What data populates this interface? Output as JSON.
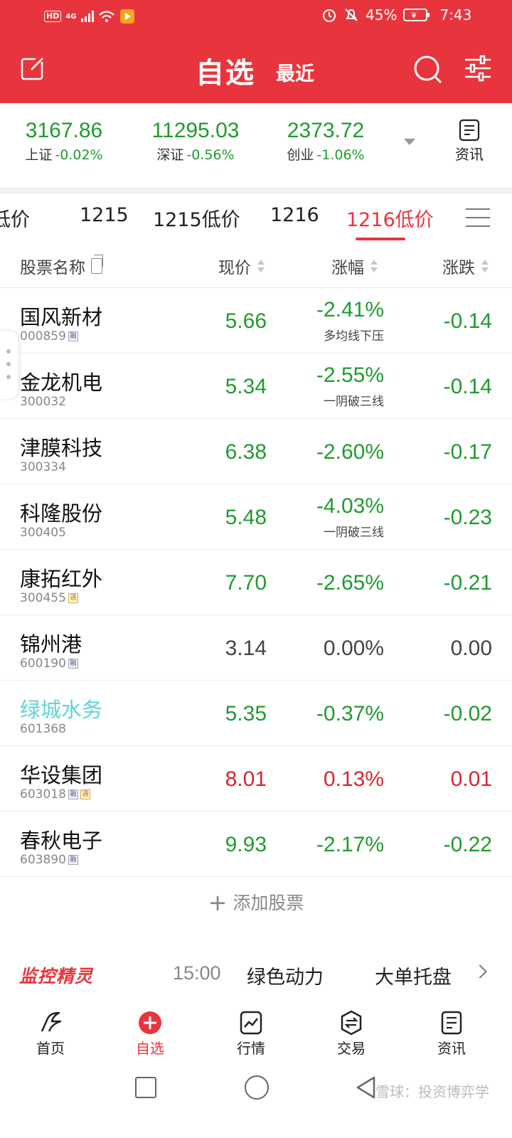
{
  "status": {
    "hd": "HD",
    "net": "4G",
    "battery": "45%",
    "time": "7:43"
  },
  "nav": {
    "title": "自选",
    "recent": "最近"
  },
  "indices": [
    {
      "value": "3167.86",
      "name": "上证",
      "change": "-0.02%"
    },
    {
      "value": "11295.03",
      "name": "深证",
      "change": "-0.56%"
    },
    {
      "value": "2373.72",
      "name": "创业",
      "change": "-1.06%"
    }
  ],
  "news_label": "资讯",
  "tabs": [
    {
      "label": "低价",
      "active": false
    },
    {
      "label": "1215",
      "active": false
    },
    {
      "label": "1215低价",
      "active": false
    },
    {
      "label": "1216",
      "active": false
    },
    {
      "label": "1216低价",
      "active": true
    }
  ],
  "columns": {
    "name": "股票名称",
    "price": "现价",
    "pct": "涨幅",
    "change": "涨跌"
  },
  "stocks": [
    {
      "name": "国风新材",
      "code": "000859",
      "badges": [
        "融"
      ],
      "price": "5.66",
      "pct": "-2.41%",
      "tip": "多均线下压",
      "change": "-0.14",
      "trend": "green"
    },
    {
      "name": "金龙机电",
      "code": "300032",
      "badges": [],
      "price": "5.34",
      "pct": "-2.55%",
      "tip": "一阴破三线",
      "change": "-0.14",
      "trend": "green"
    },
    {
      "name": "津膜科技",
      "code": "300334",
      "badges": [],
      "price": "6.38",
      "pct": "-2.60%",
      "tip": "",
      "change": "-0.17",
      "trend": "green"
    },
    {
      "name": "科隆股份",
      "code": "300405",
      "badges": [],
      "price": "5.48",
      "pct": "-4.03%",
      "tip": "一阴破三线",
      "change": "-0.23",
      "trend": "green"
    },
    {
      "name": "康拓红外",
      "code": "300455",
      "badges": [
        "通"
      ],
      "price": "7.70",
      "pct": "-2.65%",
      "tip": "",
      "change": "-0.21",
      "trend": "green"
    },
    {
      "name": "锦州港",
      "code": "600190",
      "badges": [
        "融"
      ],
      "price": "3.14",
      "pct": "0.00%",
      "tip": "",
      "change": "0.00",
      "trend": "gray"
    },
    {
      "name": "绿城水务",
      "code": "601368",
      "badges": [],
      "price": "5.35",
      "pct": "-0.37%",
      "tip": "",
      "change": "-0.02",
      "trend": "green",
      "name_color": "cyan"
    },
    {
      "name": "华设集团",
      "code": "603018",
      "badges": [
        "融",
        "通"
      ],
      "price": "8.01",
      "pct": "0.13%",
      "tip": "",
      "change": "0.01",
      "trend": "red"
    },
    {
      "name": "春秋电子",
      "code": "603890",
      "badges": [
        "融"
      ],
      "price": "9.93",
      "pct": "-2.17%",
      "tip": "",
      "change": "-0.22",
      "trend": "green"
    }
  ],
  "add_stock": "添加股票",
  "ticker": {
    "logo": "监控精灵",
    "time": "15:00",
    "item1": "绿色动力",
    "item2": "大单托盘"
  },
  "tabbar": [
    {
      "label": "首页",
      "icon": "home-icon",
      "active": false
    },
    {
      "label": "自选",
      "icon": "plus-circle-icon",
      "active": true
    },
    {
      "label": "行情",
      "icon": "chart-icon",
      "active": false
    },
    {
      "label": "交易",
      "icon": "trade-icon",
      "active": false
    },
    {
      "label": "资讯",
      "icon": "news-icon",
      "active": false
    }
  ],
  "watermark": "雪球：投资博弈学",
  "colors": {
    "brand": "#e8353d",
    "down": "#1f9b2e",
    "up": "#d8262f"
  }
}
